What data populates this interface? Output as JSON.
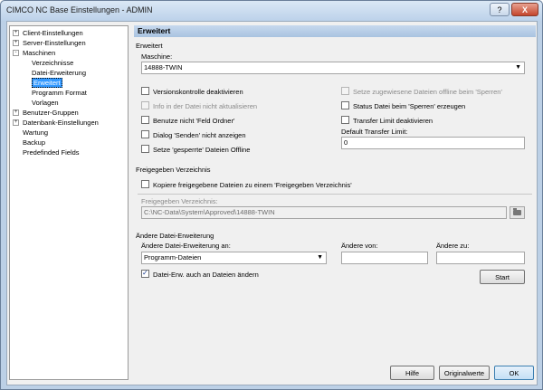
{
  "window": {
    "title": "CIMCO NC Base Einstellungen - ADMIN",
    "help_label": "?",
    "close_label": "X"
  },
  "tree": {
    "items": [
      {
        "label": "Client-Einstellungen",
        "expander": "+"
      },
      {
        "label": "Server-Einstellungen",
        "expander": "+"
      },
      {
        "label": "Maschinen",
        "expander": "-"
      },
      {
        "label": "Verzeichnisse",
        "expander": ""
      },
      {
        "label": "Datei-Erweiterung",
        "expander": ""
      },
      {
        "label": "Erweitert",
        "expander": ""
      },
      {
        "label": "Programm Format",
        "expander": ""
      },
      {
        "label": "Vorlagen",
        "expander": ""
      },
      {
        "label": "Benutzer-Gruppen",
        "expander": "+"
      },
      {
        "label": "Datenbank-Einstellungen",
        "expander": "+"
      },
      {
        "label": "Wartung",
        "expander": ""
      },
      {
        "label": "Backup",
        "expander": ""
      },
      {
        "label": "Predefinded Fields",
        "expander": ""
      }
    ]
  },
  "panel": {
    "header": "Erweitert",
    "section_label": "Erweitert",
    "machine_label": "Maschine:",
    "machine_value": "14888-TWIN",
    "checkboxes": {
      "versionskontrolle": "Versionskontrolle deaktivieren",
      "info_nicht_aktualisieren": "Info in der Datei nicht aktualisieren",
      "benutze_feld_ordner": "Benutze nicht 'Feld Ordner'",
      "dialog_senden": "Dialog 'Senden' nicht anzeigen",
      "setze_gesperrte": "Setze 'gesperrte' Dateien Offline",
      "setze_zugewiesene": "Setze zugewiesene Dateien offline beim 'Sperren'",
      "status_datei": "Status Datei beim 'Sperren' erzeugen",
      "transfer_limit": "Transfer Limit deaktivieren"
    },
    "default_transfer_limit_label": "Default Transfer Limit:",
    "default_transfer_limit_value": "0",
    "freigegeben": {
      "section_label": "Freigegeben Verzeichnis",
      "copy_label": "Kopiere freigegebene Dateien zu einem 'Freigegeben Verzeichnis'",
      "path_label": "Freigegeben Verzeichnis:",
      "path_value": "C:\\NC-Data\\System\\Approved\\14888-TWIN"
    },
    "dateierweiterung": {
      "section_label": "Ändere Datei-Erweiterung",
      "an_label": "Ändere Datei-Erweiterung an:",
      "an_value": "Programm-Dateien",
      "von_label": "Ändere von:",
      "von_value": "",
      "zu_label": "Ändere zu:",
      "zu_value": "",
      "auch_label": "Datei-Erw. auch an Dateien ändern",
      "start_label": "Start"
    }
  },
  "footer": {
    "hilfe_label": "Hilfe",
    "originalwerte_label": "Originalwerte",
    "ok_label": "OK"
  }
}
